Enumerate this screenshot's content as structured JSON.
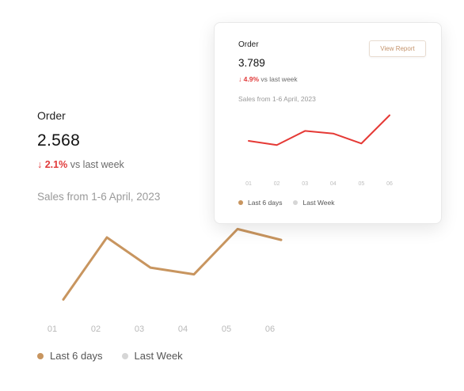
{
  "main_card": {
    "title": "Order",
    "value": "2.568",
    "delta_arrow": "↓",
    "delta_percent": "2.1%",
    "delta_suffix": " vs last week",
    "range_label": "Sales from 1-6 April, 2023",
    "legend": [
      {
        "label": "Last 6 days",
        "color": "#c8955f"
      },
      {
        "label": "Last Week",
        "color": "#d6d6d6"
      }
    ]
  },
  "popup_card": {
    "title": "Order",
    "value": "3.789",
    "delta_arrow": "↓",
    "delta_percent": "4.9%",
    "delta_suffix": " vs last week",
    "range_label": "Sales from 1-6 April, 2023",
    "button_label": "View Report",
    "legend": [
      {
        "label": "Last 6 days",
        "color": "#c8955f"
      },
      {
        "label": "Last Week",
        "color": "#d6d6d6"
      }
    ]
  },
  "chart_data": [
    {
      "type": "line",
      "categories": [
        "01",
        "02",
        "03",
        "04",
        "05",
        "06"
      ],
      "series": [
        {
          "name": "Last 6 days",
          "values": [
            10,
            84,
            48,
            40,
            94,
            81
          ],
          "color": "#c8955f"
        }
      ],
      "ylim": [
        0,
        100
      ]
    },
    {
      "type": "line",
      "categories": [
        "01",
        "02",
        "03",
        "04",
        "05",
        "06"
      ],
      "series": [
        {
          "name": "Last 6 days",
          "values": [
            44,
            36,
            63,
            58,
            39,
            93
          ],
          "color": "#e53935"
        }
      ],
      "ylim": [
        0,
        100
      ]
    }
  ]
}
